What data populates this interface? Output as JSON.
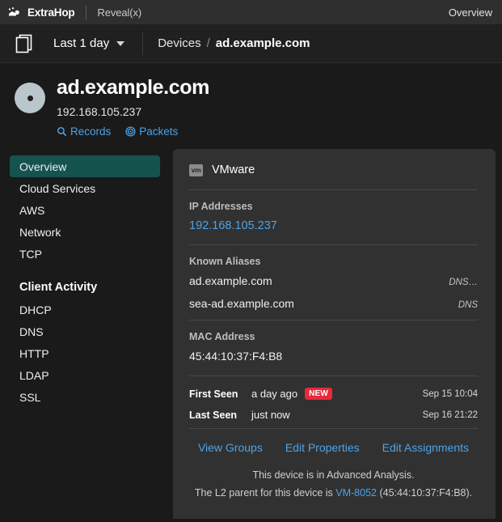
{
  "topbar": {
    "brand": "ExtraHop",
    "product": "Reveal(x)",
    "right_label": "Overview",
    "logo_icon": "extrahop-logo-icon"
  },
  "navbar": {
    "pages_icon": "pages-icon",
    "timeframe": "Last 1 day",
    "caret_icon": "chevron-down-icon",
    "breadcrumb": {
      "parent": "Devices",
      "separator": "/",
      "current": "ad.example.com"
    }
  },
  "device": {
    "avatar_icon": "device-avatar-icon",
    "name": "ad.example.com",
    "ip": "192.168.105.237",
    "links": [
      {
        "label": "Records",
        "icon": "search-icon"
      },
      {
        "label": "Packets",
        "icon": "packets-target-icon"
      }
    ]
  },
  "sidebar": {
    "items": [
      {
        "label": "Overview",
        "active": true
      },
      {
        "label": "Cloud Services",
        "active": false
      },
      {
        "label": "AWS",
        "active": false
      },
      {
        "label": "Network",
        "active": false
      },
      {
        "label": "TCP",
        "active": false
      }
    ],
    "group_title": "Client Activity",
    "group_items": [
      {
        "label": "DHCP"
      },
      {
        "label": "DNS"
      },
      {
        "label": "HTTP"
      },
      {
        "label": "LDAP"
      },
      {
        "label": "SSL"
      }
    ]
  },
  "panel": {
    "vendor": {
      "badge": "vm",
      "name": "VMware",
      "icon": "vmware-icon"
    },
    "ip_section": {
      "label": "IP Addresses",
      "value": "192.168.105.237"
    },
    "aliases_section": {
      "label": "Known Aliases",
      "rows": [
        {
          "name": "ad.example.com",
          "source": "DNS…"
        },
        {
          "name": "sea-ad.example.com",
          "source": "DNS"
        }
      ]
    },
    "mac_section": {
      "label": "MAC Address",
      "value": "45:44:10:37:F4:B8"
    },
    "seen": [
      {
        "label": "First Seen",
        "relative": "a day ago",
        "badge": "NEW",
        "absolute": "Sep 15 10:04"
      },
      {
        "label": "Last Seen",
        "relative": "just now",
        "badge": "",
        "absolute": "Sep 16 21:22"
      }
    ],
    "actions": [
      {
        "label": "View Groups"
      },
      {
        "label": "Edit Properties"
      },
      {
        "label": "Edit Assignments"
      }
    ],
    "footnote": {
      "line1": "This device is in Advanced Analysis.",
      "line2_prefix": "The L2 parent for this device is ",
      "line2_link": "VM-8052",
      "line2_suffix": " (45:44:10:37:F4:B8)."
    }
  },
  "colors": {
    "page_bg": "#1a1a1a",
    "panel_bg": "#313131",
    "topbar_bg": "#2f2f2f",
    "accent_link": "#4ba3e8",
    "active_nav": "#15534f",
    "badge_new": "#e8293c"
  }
}
